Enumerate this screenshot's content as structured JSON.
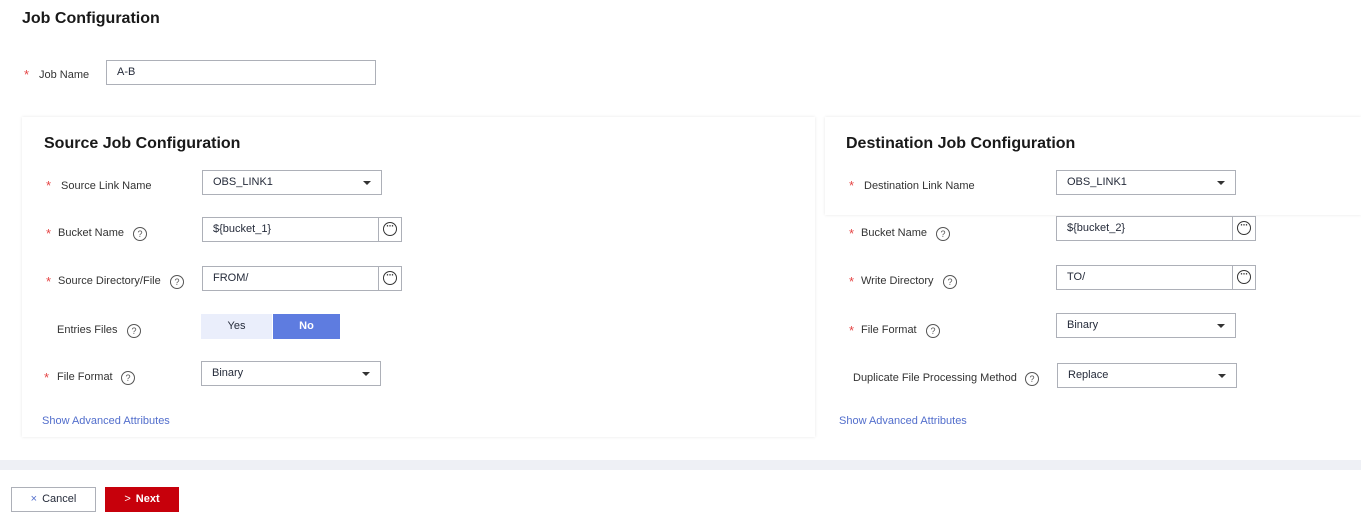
{
  "page": {
    "title": "Job Configuration"
  },
  "job_name": {
    "label": "Job Name",
    "value": "A-B",
    "required_mark": "*"
  },
  "source": {
    "title": "Source Job Configuration",
    "link_name": {
      "label": "Source Link Name",
      "value": "OBS_LINK1"
    },
    "bucket_name": {
      "label": "Bucket Name",
      "value": "${bucket_1}"
    },
    "directory": {
      "label": "Source Directory/File",
      "value": "FROM/"
    },
    "entries_files": {
      "label": "Entries Files",
      "options": [
        "Yes",
        "No"
      ],
      "selected": "No"
    },
    "file_format": {
      "label": "File Format",
      "value": "Binary"
    },
    "advanced_link": "Show Advanced Attributes"
  },
  "destination": {
    "title": "Destination Job Configuration",
    "link_name": {
      "label": "Destination Link Name",
      "value": "OBS_LINK1"
    },
    "bucket_name": {
      "label": "Bucket Name",
      "value": "${bucket_2}"
    },
    "write_directory": {
      "label": "Write Directory",
      "value": "TO/"
    },
    "file_format": {
      "label": "File Format",
      "value": "Binary"
    },
    "duplicate_method": {
      "label": "Duplicate File Processing Method",
      "value": "Replace"
    },
    "advanced_link": "Show Advanced Attributes"
  },
  "footer": {
    "cancel_icon": "×",
    "cancel_label": "Cancel",
    "next_icon": ">",
    "next_label": "Next"
  },
  "glyphs": {
    "help": "?",
    "more": "···"
  },
  "colors": {
    "accent": "#5e7ce0",
    "required": "#e54545",
    "link": "#526ecc",
    "primary_button": "#c7000b",
    "segment_unselected": "#eaeefb"
  }
}
